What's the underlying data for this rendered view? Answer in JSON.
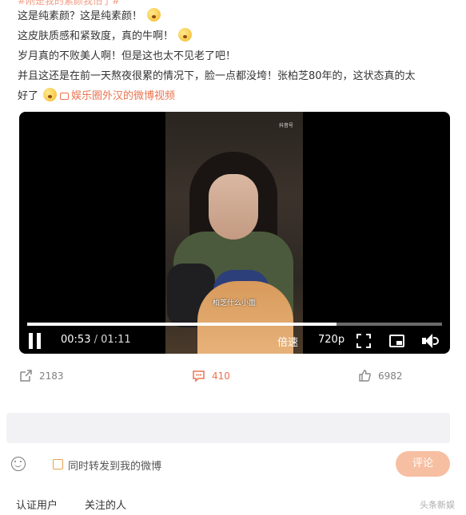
{
  "post": {
    "top_cut_text": "#刚是我的素颜我怕了#",
    "lines": [
      "这是纯素颜？这是纯素颜！",
      "这皮肤质感和紧致度，真的牛啊！",
      "岁月真的不败美人啊！但是这也太不见老了吧！",
      "并且这还是在前一天熬夜很累的情况下，脸一点都没垮！张柏芝80年的，这状态真的太",
      "好了"
    ],
    "video_link": "娱乐圈外汉的微博视频"
  },
  "video": {
    "watermark": "抖音号",
    "subtitle": "柏芝什么小面",
    "current_time": "00:53",
    "separator": "/",
    "duration": "01:11",
    "progress": 0.746,
    "speed_label": "倍速",
    "quality_label": "720p",
    "icons": [
      "pause-icon",
      "fullscreen-icon",
      "pip-icon",
      "volume-icon"
    ]
  },
  "actions": {
    "forward_count": "2183",
    "comment_count": "410",
    "like_count": "6982"
  },
  "composer": {
    "repost_label": "同时转发到我的微博",
    "submit_label": "评论"
  },
  "filters": {
    "verified": "认证用户",
    "following": "关注的人"
  },
  "watermark_stamp": "头条新娱",
  "colors": {
    "accent": "#eb7350",
    "submit_bg": "#f7bfa2",
    "video_bg": "#000000"
  }
}
